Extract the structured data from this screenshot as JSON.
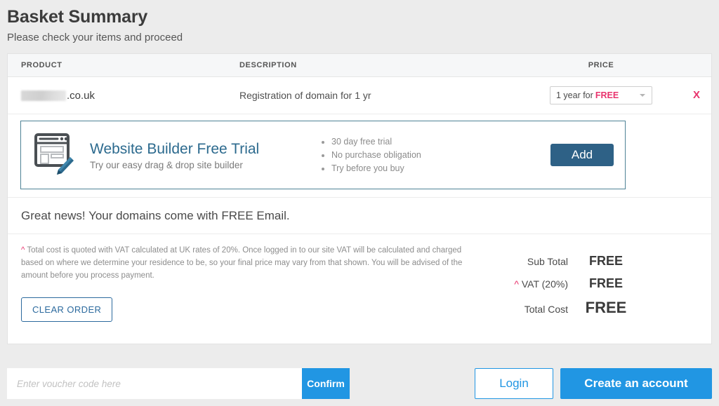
{
  "header": {
    "title": "Basket Summary",
    "subtitle": "Please check your items and proceed"
  },
  "table": {
    "columns": {
      "product": "PRODUCT",
      "description": "DESCRIPTION",
      "price": "PRICE"
    },
    "row": {
      "domain_suffix": ".co.uk",
      "domain_name_redacted": true,
      "description": "Registration of domain for 1 yr",
      "term_prefix": "1 year for",
      "term_price": "FREE",
      "remove_label": "X"
    }
  },
  "promo": {
    "icon": "website-builder-icon",
    "title": "Website Builder Free Trial",
    "subtitle": "Try our easy drag & drop site builder",
    "bullets": [
      "30 day free trial",
      "No purchase obligation",
      "Try before you buy"
    ],
    "add_label": "Add"
  },
  "notice": {
    "free_email": "Great news! Your domains come with FREE Email."
  },
  "vat_note": {
    "marker": "^",
    "text": " Total cost is quoted with VAT calculated at UK rates of 20%. Once logged in to our site VAT will be calculated and charged based on where we determine your residence to be, so your final price may vary from that shown. You will be advised of the amount before you process payment."
  },
  "actions": {
    "clear_order": "CLEAR ORDER"
  },
  "totals": {
    "sub_total_label": "Sub Total",
    "sub_total_value": "FREE",
    "vat_marker": "^",
    "vat_label": " VAT (20%)",
    "vat_value": "FREE",
    "total_label": "Total Cost",
    "total_value": "FREE"
  },
  "bottom": {
    "voucher_placeholder": "Enter voucher code here",
    "voucher_value": "",
    "confirm_label": "Confirm",
    "login_label": "Login",
    "create_account_label": "Create an account"
  },
  "colors": {
    "accent_blue": "#2196e3",
    "promo_blue": "#2c6a8e",
    "promo_border": "#4f8296",
    "add_button": "#2e6186",
    "pink": "#e8336d",
    "page_bg": "#ececec"
  }
}
